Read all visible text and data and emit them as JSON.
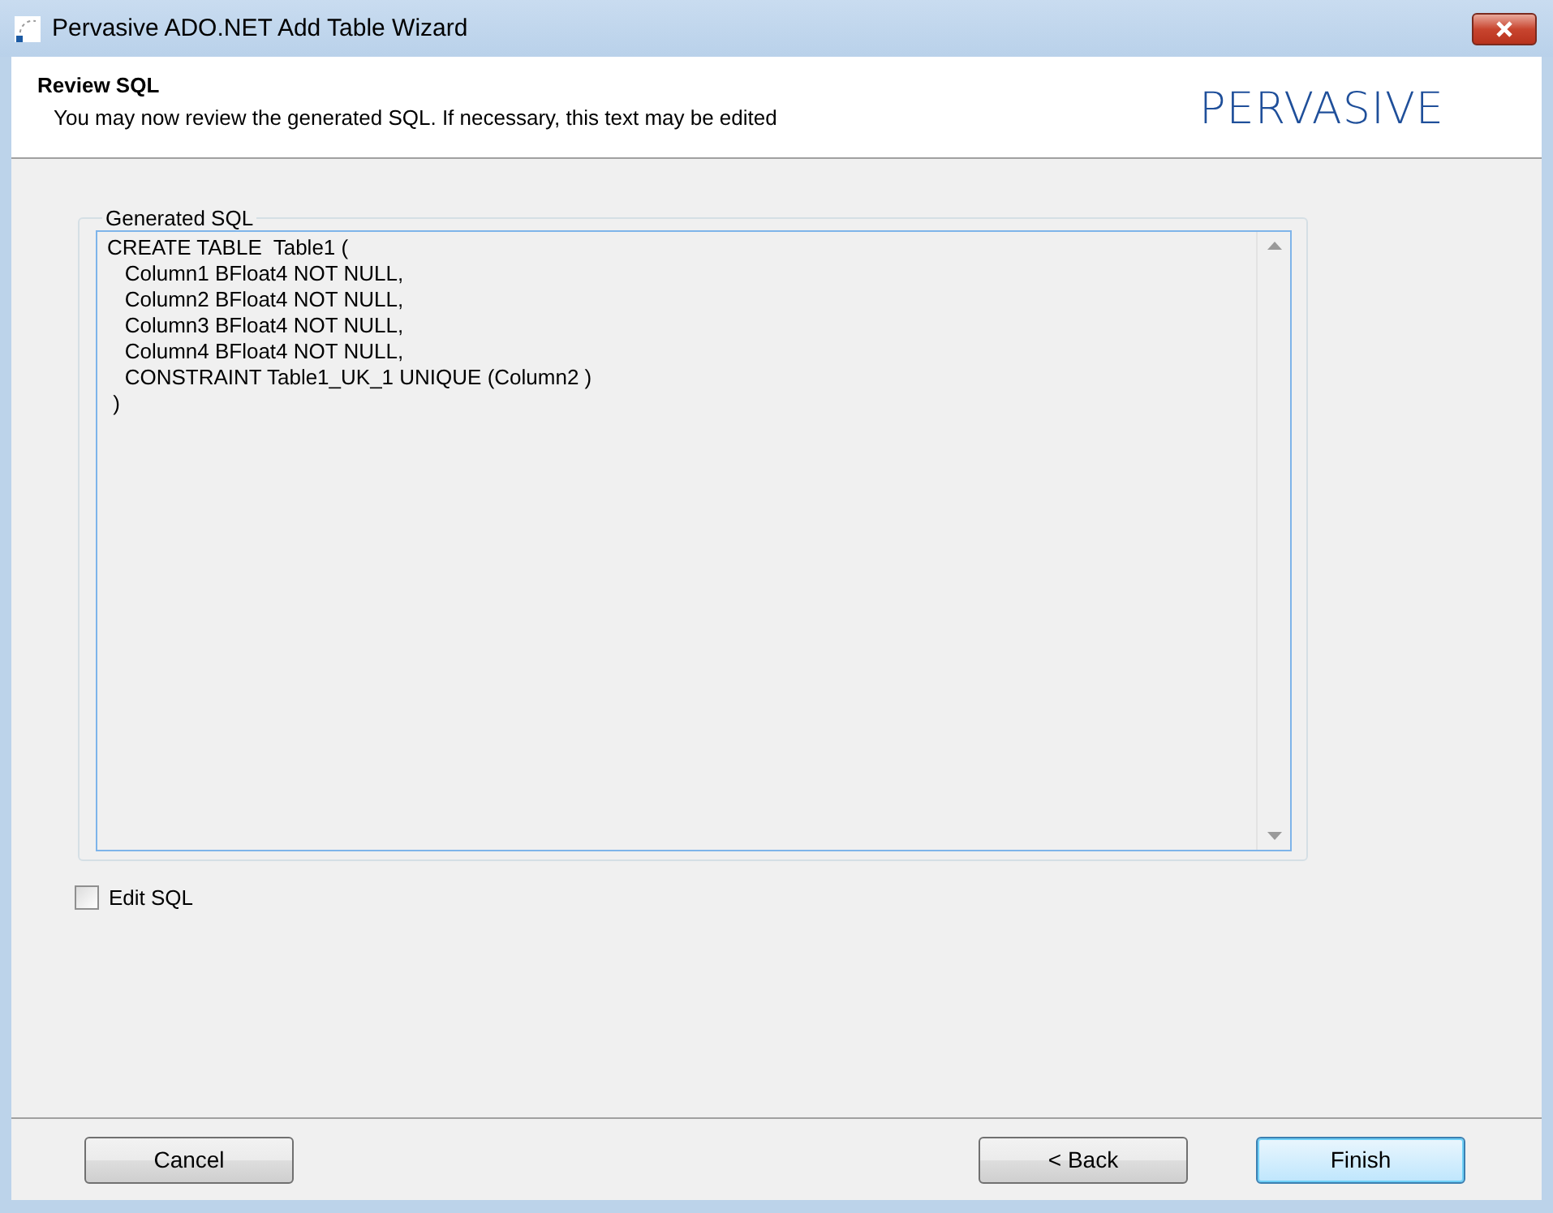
{
  "window": {
    "title": "Pervasive ADO.NET Add Table Wizard"
  },
  "header": {
    "title": "Review SQL",
    "subtitle": "You may now review the generated SQL. If necessary, this text may be edited",
    "logo": "PERVASIVE"
  },
  "group": {
    "label": "Generated SQL",
    "sql_lines": [
      "CREATE TABLE  Table1 (",
      "   Column1 BFloat4 NOT NULL,",
      "   Column2 BFloat4 NOT NULL,",
      "   Column3 BFloat4 NOT NULL,",
      "   Column4 BFloat4 NOT NULL,",
      "   CONSTRAINT Table1_UK_1 UNIQUE (Column2 )",
      " )"
    ]
  },
  "edit_sql": {
    "label": "Edit SQL",
    "checked": false
  },
  "buttons": [
    {
      "label": "Cancel",
      "default": false
    },
    {
      "label": "< Back",
      "default": false
    },
    {
      "label": "Finish",
      "default": true
    }
  ]
}
